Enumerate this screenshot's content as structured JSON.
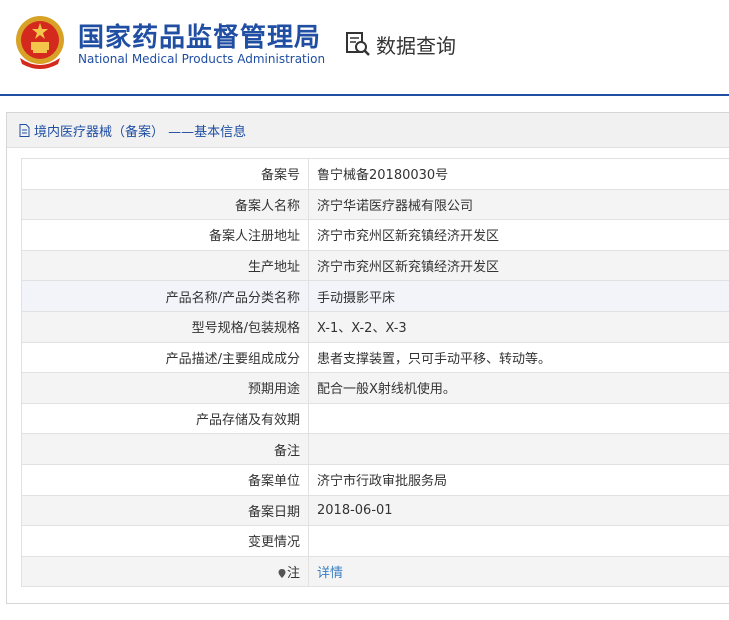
{
  "header": {
    "org_name_cn": "国家药品监督管理局",
    "org_name_en": "National Medical Products Administration",
    "query_title": "数据查询",
    "emblem_icon": "national-emblem-icon",
    "query_icon": "document-search-icon",
    "brand_color": "#1f4ea3"
  },
  "panel": {
    "title": "境内医疗器械（备案） ——基本信息",
    "title_icon": "document-icon"
  },
  "rows": [
    {
      "label": "备案号",
      "value": "鲁宁械备20180030号"
    },
    {
      "label": "备案人名称",
      "value": "济宁华诺医疗器械有限公司"
    },
    {
      "label": "备案人注册地址",
      "value": "济宁市兖州区新兖镇经济开发区"
    },
    {
      "label": "生产地址",
      "value": "济宁市兖州区新兖镇经济开发区"
    },
    {
      "label": "产品名称/产品分类名称",
      "value": "手动摄影平床"
    },
    {
      "label": "型号规格/包装规格",
      "value": "X-1、X-2、X-3"
    },
    {
      "label": "产品描述/主要组成成分",
      "value": "患者支撑装置，只可手动平移、转动等。"
    },
    {
      "label": "预期用途",
      "value": "配合一般X射线机使用。"
    },
    {
      "label": "产品存储及有效期",
      "value": ""
    },
    {
      "label": "备注",
      "value": ""
    },
    {
      "label": "备案单位",
      "value": "济宁市行政审批服务局"
    },
    {
      "label": "备案日期",
      "value": "2018-06-01"
    },
    {
      "label": "变更情况",
      "value": ""
    },
    {
      "label": "注",
      "value": "详情"
    }
  ],
  "colors": {
    "link": "#3a7fc4",
    "row_alt": "#f4f4f4"
  }
}
